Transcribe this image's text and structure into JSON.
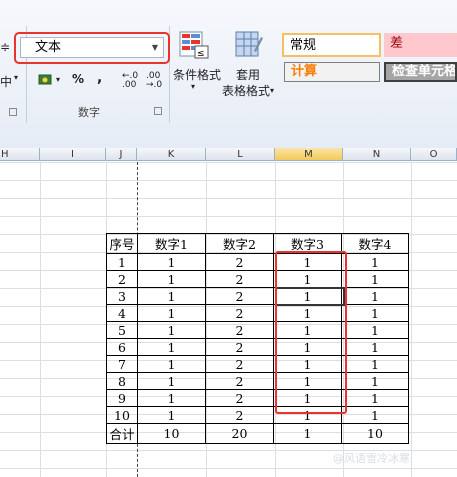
{
  "ribbon": {
    "number_format_value": "文本",
    "align_label": "中",
    "number_group_label": "数字",
    "percent_symbol": "%",
    "comma_symbol": ",",
    "increase_decimal": "←.0 .00",
    "decrease_decimal": ".00 →.0",
    "conditional_format_label": "条件格式",
    "table_format_label_1": "套用",
    "table_format_label_2": "表格格式",
    "styles": {
      "normal": "常规",
      "bad": "差",
      "calc": "计算",
      "check_cell": "检查单元格"
    },
    "colors": {
      "highlight_red": "#e8342c",
      "bad_fill": "#ffc7ce",
      "calc_text": "#fa7d00",
      "check_fill": "#a5a5a5"
    }
  },
  "columns": [
    "H",
    "I",
    "J",
    "K",
    "L",
    "M",
    "N",
    "O"
  ],
  "selected_column": "M",
  "table": {
    "headers": [
      "序号",
      "数字1",
      "数字2",
      "数字3",
      "数字4"
    ],
    "rows": [
      [
        "1",
        "1",
        "2",
        "1",
        "1"
      ],
      [
        "2",
        "1",
        "2",
        "1",
        "1"
      ],
      [
        "3",
        "1",
        "2",
        "1",
        "1"
      ],
      [
        "4",
        "1",
        "2",
        "1",
        "1"
      ],
      [
        "5",
        "1",
        "2",
        "1",
        "1"
      ],
      [
        "6",
        "1",
        "2",
        "1",
        "1"
      ],
      [
        "7",
        "1",
        "2",
        "1",
        "1"
      ],
      [
        "8",
        "1",
        "2",
        "1",
        "1"
      ],
      [
        "9",
        "1",
        "2",
        "1",
        "1"
      ],
      [
        "10",
        "1",
        "2",
        "1",
        "1"
      ]
    ],
    "total": [
      "合计",
      "10",
      "20",
      "1",
      "10"
    ]
  },
  "watermark": "@风语雪冷冰寒"
}
